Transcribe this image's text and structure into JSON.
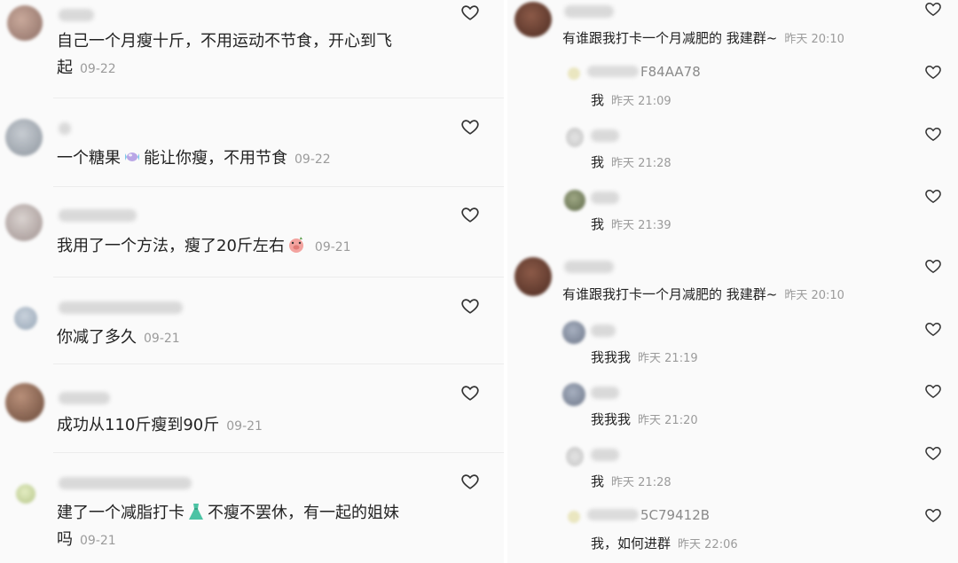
{
  "left": {
    "comments": [
      {
        "text": "自己一个月瘦十斤，不用运动不节食，开心到飞",
        "text2": "起",
        "date": "09-22"
      },
      {
        "text_a": "一个糖果",
        "text_b": "能让你瘦，不用节食",
        "date": "09-22",
        "emoji": "candy-emoji"
      },
      {
        "text": "我用了一个方法，瘦了20斤左右",
        "date": "09-21",
        "emoji": "pig-face-emoji"
      },
      {
        "text": "你减了多久",
        "date": "09-21"
      },
      {
        "text": "成功从110斤瘦到90斤",
        "date": "09-21"
      },
      {
        "text_a": "建了一个减脂打卡",
        "text_b": "不瘦不罢休，有一起的姐妹",
        "text2": "吗",
        "date": "09-21",
        "emoji": "dress-emoji"
      }
    ]
  },
  "right": {
    "threads": [
      {
        "text": "有谁跟我打卡一个月减肥的 我建群~",
        "time": "昨天 20:10",
        "replies": [
          {
            "uid": "F84AA78",
            "text": "我",
            "time": "昨天 21:09"
          },
          {
            "uid": "",
            "text": "我",
            "time": "昨天 21:28"
          },
          {
            "uid": "",
            "text": "我",
            "time": "昨天 21:39"
          }
        ]
      },
      {
        "text": "有谁跟我打卡一个月减肥的 我建群~",
        "time": "昨天 20:10",
        "replies": [
          {
            "uid": "",
            "text": "我我我",
            "time": "昨天 21:19"
          },
          {
            "uid": "",
            "text": "我我我",
            "time": "昨天 21:20"
          },
          {
            "uid": "",
            "text": "我",
            "time": "昨天 21:28"
          },
          {
            "uid": "5C79412B",
            "text": "我，如何进群",
            "time": "昨天 22:06"
          }
        ]
      }
    ]
  },
  "icons": {
    "like": "heart-outline-icon"
  },
  "colors": {
    "text": "#222222",
    "meta": "#9b9b9b",
    "background": "#fafafa"
  }
}
